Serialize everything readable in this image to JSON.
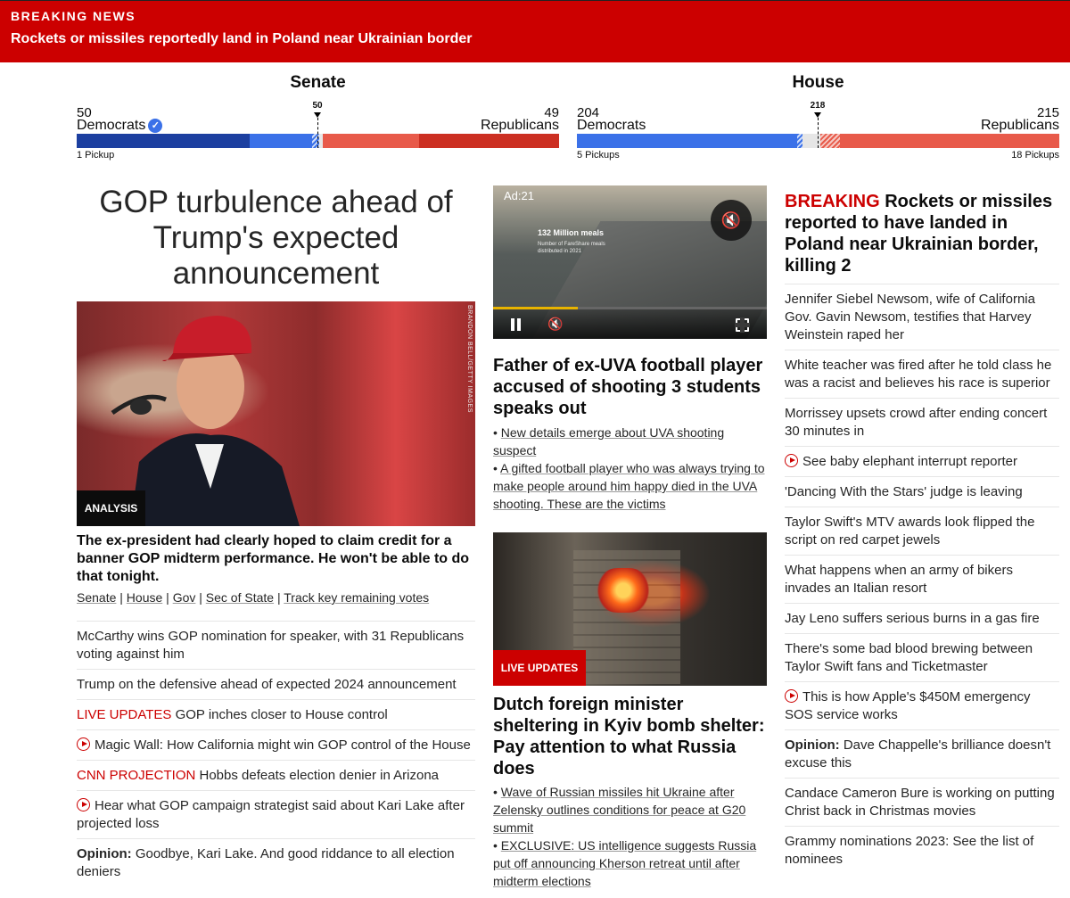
{
  "banner": {
    "kicker": "BREAKING NEWS",
    "headline": "Rockets or missiles reportedly land in Poland near Ukrainian border"
  },
  "senate": {
    "title": "Senate",
    "left_number": "50",
    "left_party": "Democrats",
    "right_number": "49",
    "right_party": "Republicans",
    "threshold": "50",
    "left_footer": "1 Pickup",
    "right_footer": "",
    "colors": {
      "dem_dark": "#1c3fa0",
      "dem": "#3b71e8",
      "rep_dark": "#cc2f22",
      "rep": "#e85a4a"
    }
  },
  "house": {
    "title": "House",
    "left_number": "204",
    "left_party": "Democrats",
    "right_number": "215",
    "right_party": "Republicans",
    "threshold": "218",
    "left_footer": "5 Pickups",
    "right_footer": "18 Pickups"
  },
  "lead": {
    "headline": "GOP turbulence ahead of Trump's expected announcement",
    "photo_credit": "BRANDON BELL/GETTY IMAGES",
    "badge": "ANALYSIS",
    "description": "The ex-president had clearly hoped to claim credit for a banner GOP midterm performance. He won't be able to do that tonight.",
    "links": [
      "Senate",
      "House",
      "Gov",
      "Sec of State",
      "Track key remaining votes"
    ]
  },
  "left_list": [
    {
      "prefix": "",
      "text": "McCarthy wins GOP nomination for speaker, with 31 Republicans voting against him"
    },
    {
      "prefix": "",
      "text": "Trump on the defensive ahead of expected 2024 announcement"
    },
    {
      "prefix": "LIVE UPDATES",
      "text": " GOP inches closer to House control"
    },
    {
      "prefix": "",
      "text": "Magic Wall: How California might win GOP control of the House",
      "video": true
    },
    {
      "prefix": "CNN PROJECTION",
      "text": " Hobbs defeats election denier in Arizona"
    },
    {
      "prefix": "",
      "text": "Hear what GOP campaign strategist said about Kari Lake after projected loss",
      "video": true
    },
    {
      "opinion": "Opinion:",
      "text": " Goodbye, Kari Lake. And good riddance to all election deniers"
    }
  ],
  "video": {
    "ad_label": "Ad:21",
    "overlay_title": "132 Million meals",
    "overlay_sub": "Number of FareShare meals distributed in 2021",
    "progress": 0.31,
    "colors": {
      "progress": "#e8b300"
    }
  },
  "story1": {
    "headline": "Father of ex-UVA football player accused of shooting 3 students speaks out",
    "bullets": [
      "New details emerge about UVA shooting suspect",
      "A gifted football player who was always trying to make people around him happy died in the UVA shooting. These are the victims"
    ]
  },
  "story2": {
    "badge": "LIVE UPDATES",
    "headline": "Dutch foreign minister sheltering in Kyiv bomb shelter: Pay attention to what Russia does",
    "bullets": [
      "Wave of Russian missiles hit Ukraine after Zelensky outlines conditions for peace at G20 summit",
      "EXCLUSIVE: US intelligence suggests Russia put off announcing Kherson retreat until after midterm elections"
    ]
  },
  "right": {
    "kicker": "BREAKING",
    "headline": " Rockets or missiles reported to have landed in Poland near Ukrainian border, killing 2",
    "list": [
      {
        "text": "Jennifer Siebel Newsom, wife of California Gov. Gavin Newsom, testifies that Harvey Weinstein raped her"
      },
      {
        "text": "White teacher was fired after he told class he was a racist and believes his race is superior"
      },
      {
        "text": "Morrissey upsets crowd after ending concert 30 minutes in"
      },
      {
        "text": "See baby elephant interrupt reporter",
        "video": true
      },
      {
        "text": "'Dancing With the Stars' judge is leaving"
      },
      {
        "text": "Taylor Swift's MTV awards look flipped the script on red carpet jewels"
      },
      {
        "text": "What happens when an army of bikers invades an Italian resort"
      },
      {
        "text": "Jay Leno suffers serious burns in a gas fire"
      },
      {
        "text": "There's some bad blood brewing between Taylor Swift fans and Ticketmaster"
      },
      {
        "text": "This is how Apple's $450M emergency SOS service works",
        "video": true
      },
      {
        "opinion": "Opinion:",
        "text": " Dave Chappelle's brilliance doesn't excuse this"
      },
      {
        "text": "Candace Cameron Bure is working on putting Christ back in Christmas movies"
      },
      {
        "text": "Grammy nominations 2023: See the list of nominees"
      }
    ]
  }
}
